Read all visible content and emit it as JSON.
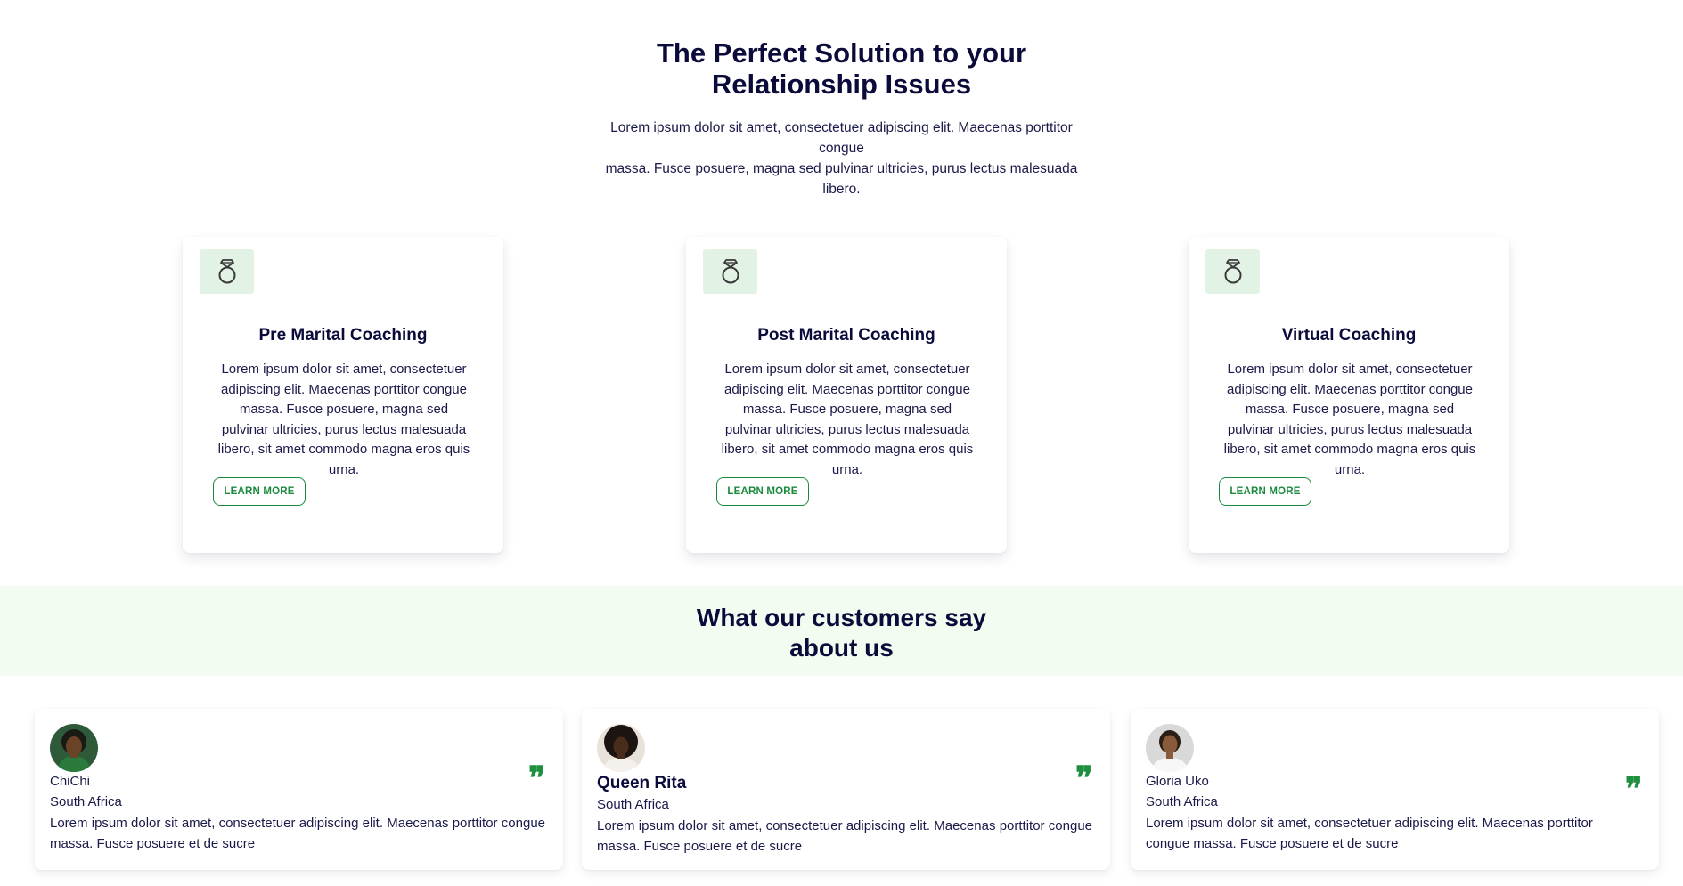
{
  "hero": {
    "title_line1": "The Perfect Solution to your",
    "title_line2": "Relationship Issues",
    "text_line1": "Lorem ipsum dolor sit amet, consectetuer adipiscing elit. Maecenas porttitor congue",
    "text_line2": "massa. Fusce posuere, magna sed pulvinar ultricies, purus lectus malesuada libero."
  },
  "services": [
    {
      "icon": "ring-icon",
      "title": "Pre Marital Coaching",
      "text": "Lorem ipsum dolor sit amet, consectetuer adipiscing elit. Maecenas porttitor congue massa. Fusce posuere, magna sed pulvinar ultricies, purus lectus malesuada libero, sit amet commodo magna eros quis urna.",
      "button": "LEARN MORE"
    },
    {
      "icon": "ring-icon",
      "title": "Post Marital Coaching",
      "text": "Lorem ipsum dolor sit amet, consectetuer adipiscing elit. Maecenas porttitor congue massa. Fusce posuere, magna sed pulvinar ultricies, purus lectus malesuada libero, sit amet commodo magna eros quis urna.",
      "button": "LEARN MORE"
    },
    {
      "icon": "ring-icon",
      "title": "Virtual Coaching",
      "text": "Lorem ipsum dolor sit amet, consectetuer adipiscing elit. Maecenas porttitor congue massa. Fusce posuere, magna sed pulvinar ultricies, purus lectus malesuada libero, sit amet commodo magna eros quis urna.",
      "button": "LEARN MORE"
    }
  ],
  "testimonials": {
    "title_line1": "What our customers say",
    "title_line2": "about us",
    "items": [
      {
        "name": "ChiChi",
        "location": "South Africa",
        "text": "Lorem ipsum dolor sit amet, consectetuer adipiscing elit. Maecenas porttitor congue massa. Fusce posuere et de sucre",
        "quote_icon": "quote-icon"
      },
      {
        "name": "Queen Rita",
        "location": "South Africa",
        "text": "Lorem ipsum dolor sit amet, consectetuer adipiscing elit. Maecenas porttitor congue massa. Fusce posuere et de sucre",
        "quote_icon": "quote-icon"
      },
      {
        "name": "Gloria Uko",
        "location": "South Africa",
        "text": "Lorem ipsum dolor sit amet, consectetuer adipiscing elit. Maecenas porttitor congue massa. Fusce posuere et de sucre",
        "quote_icon": "quote-icon"
      }
    ]
  },
  "colors": {
    "accent_green": "#1a8a3e",
    "icon_bg": "#e2f3e6",
    "band_bg": "#f3fcf1",
    "heading": "#0b0b3b"
  }
}
